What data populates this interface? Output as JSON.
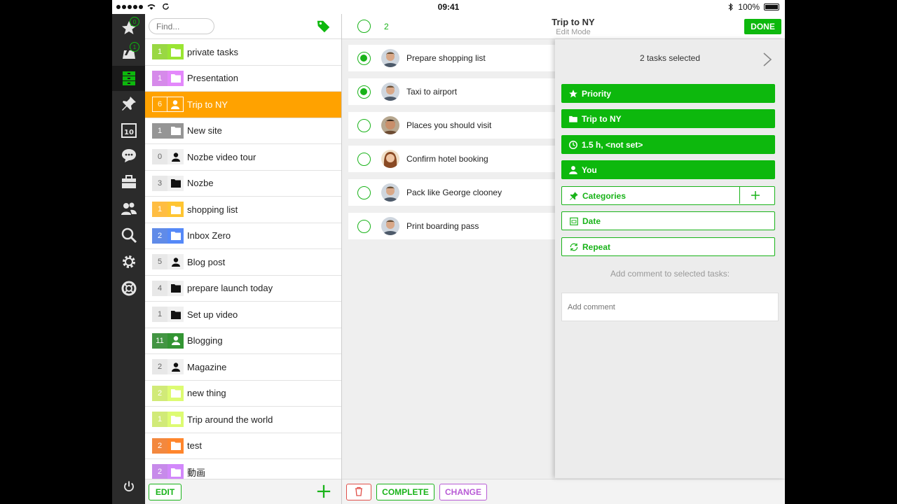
{
  "status": {
    "time": "09:41",
    "battery": "100%"
  },
  "rail": {
    "badges": {
      "priority": "0",
      "inbox": "1"
    },
    "calendar_day": "10"
  },
  "projects": {
    "search_placeholder": "Find...",
    "edit_label": "EDIT",
    "items": [
      {
        "count": "1",
        "name": "private tasks",
        "color": "#8fd42f",
        "icon": "folder",
        "selected": false
      },
      {
        "count": "1",
        "name": "Presentation",
        "color": "#d27ee8",
        "icon": "folder",
        "selected": false
      },
      {
        "count": "6",
        "name": "Trip to NY",
        "color": "#ffa200",
        "icon": "person",
        "selected": true
      },
      {
        "count": "1",
        "name": "New site",
        "color": "#8a8a8a",
        "icon": "folder",
        "selected": false
      },
      {
        "count": "0",
        "name": "Nozbe video tour",
        "color": "#e6e6e6",
        "icon": "person-dark",
        "selected": false
      },
      {
        "count": "3",
        "name": "Nozbe",
        "color": "#e6e6e6",
        "icon": "folder-dark",
        "selected": false
      },
      {
        "count": "1",
        "name": "shopping list",
        "color": "#ffb62e",
        "icon": "folder",
        "selected": false
      },
      {
        "count": "2",
        "name": "Inbox Zero",
        "color": "#4f7fe6",
        "icon": "folder",
        "selected": false
      },
      {
        "count": "5",
        "name": "Blog post",
        "color": "#e6e6e6",
        "icon": "person-dark",
        "selected": false
      },
      {
        "count": "4",
        "name": "prepare launch today",
        "color": "#e6e6e6",
        "icon": "folder-dark",
        "selected": false
      },
      {
        "count": "1",
        "name": "Set up video",
        "color": "#e6e6e6",
        "icon": "folder-dark",
        "selected": false
      },
      {
        "count": "11",
        "name": "Blogging",
        "color": "#2f8a2f",
        "icon": "person",
        "selected": false
      },
      {
        "count": "2",
        "name": "Magazine",
        "color": "#e6e6e6",
        "icon": "person-dark",
        "selected": false
      },
      {
        "count": "2",
        "name": "new thing",
        "color": "#cde86a",
        "icon": "folder",
        "selected": false
      },
      {
        "count": "1",
        "name": "Trip around the world",
        "color": "#cde86a",
        "icon": "folder",
        "selected": false
      },
      {
        "count": "2",
        "name": "test",
        "color": "#f27c2a",
        "icon": "folder",
        "selected": false
      },
      {
        "count": "2",
        "name": "動画",
        "color": "#c27ee8",
        "icon": "folder",
        "selected": false
      }
    ]
  },
  "header": {
    "selected_count": "2",
    "title": "Trip to NY",
    "subtitle": "Edit Mode",
    "done_label": "DONE"
  },
  "tasks": [
    {
      "title": "Prepare shopping list",
      "checked": true,
      "avatar": "man"
    },
    {
      "title": "Taxi to airport",
      "checked": true,
      "avatar": "man"
    },
    {
      "title": "Places you should visit",
      "checked": false,
      "avatar": "man2"
    },
    {
      "title": "Confirm hotel booking",
      "checked": false,
      "avatar": "woman"
    },
    {
      "title": "Pack like George clooney",
      "checked": false,
      "avatar": "man"
    },
    {
      "title": "Print boarding pass",
      "checked": false,
      "avatar": "man"
    }
  ],
  "footer": {
    "complete_label": "COMPLETE",
    "change_label": "CHANGE"
  },
  "panel": {
    "title": "2 tasks selected",
    "priority_label": "Priority",
    "project_label": "Trip to NY",
    "time_label": "1.5 h, <not set>",
    "responsible_label": "You",
    "categories_label": "Categories",
    "date_label": "Date",
    "repeat_label": "Repeat",
    "comment_label": "Add comment to selected tasks:",
    "comment_placeholder": "Add comment"
  },
  "colors": {
    "accent": "#0db80d",
    "selected": "#ffa200",
    "rail": "#2b2b2b"
  }
}
